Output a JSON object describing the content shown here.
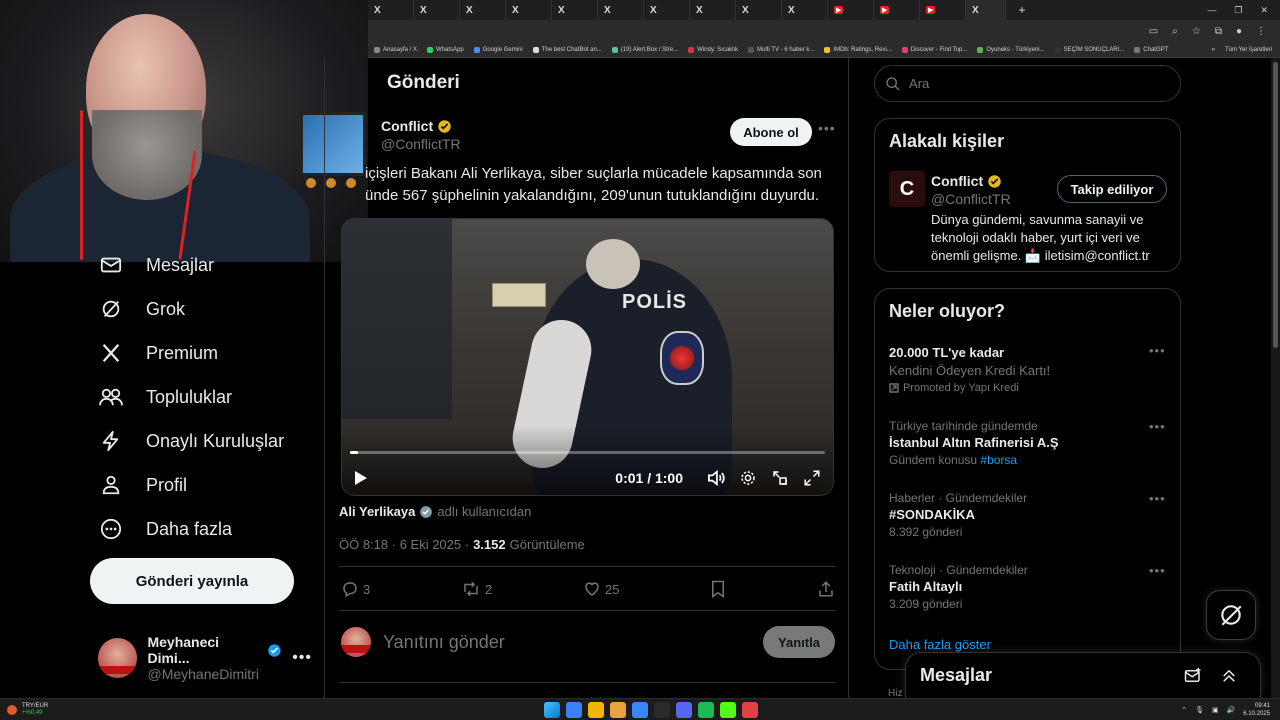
{
  "browser": {
    "tabs": [
      "X",
      "X",
      "X",
      "X",
      "X",
      "X",
      "X",
      "X",
      "X",
      "X",
      "X",
      "X",
      "X"
    ],
    "active_tab": "X",
    "new_tab": "+",
    "bookmarks": [
      {
        "label": "Anasayfa / X",
        "color": "#888888"
      },
      {
        "label": "WhatsApp",
        "color": "#25d366"
      },
      {
        "label": "Google Gemini",
        "color": "#4e8cf5"
      },
      {
        "label": "The best ChatBot an...",
        "color": "#dddddd"
      },
      {
        "label": "(19) Alert Box / Stre...",
        "color": "#53c6a8"
      },
      {
        "label": "Windy: Sıcaklık",
        "color": "#d2354a"
      },
      {
        "label": "Multi TV - 6 haber k...",
        "color": "#555555"
      },
      {
        "label": "IMDb: Ratings, Revi...",
        "color": "#f5c518"
      },
      {
        "label": "Discover - Find Top...",
        "color": "#e04070"
      },
      {
        "label": "Oyuneks - Türkiyeni...",
        "color": "#5bb552"
      },
      {
        "label": "SEÇİM SONUÇLARI...",
        "color": "#333333"
      },
      {
        "label": "ChatGPT",
        "color": "#777777"
      }
    ],
    "bookmarks_more": "»",
    "bookmarks_folder": "Tüm Yer İşaretleri"
  },
  "sidebar": {
    "items": [
      {
        "label": "Mesajlar",
        "icon": "mail-icon"
      },
      {
        "label": "Grok",
        "icon": "grok-icon"
      },
      {
        "label": "Premium",
        "icon": "x-logo-icon"
      },
      {
        "label": "Topluluklar",
        "icon": "communities-icon"
      },
      {
        "label": "Onaylı Kuruluşlar",
        "icon": "lightning-icon"
      },
      {
        "label": "Profil",
        "icon": "person-icon"
      },
      {
        "label": "Daha fazla",
        "icon": "more-circle-icon"
      }
    ],
    "post_button": "Gönderi yayınla",
    "account": {
      "name": "Meyhaneci Dimi...",
      "handle": "@MeyhaneDimitri",
      "more": "•••"
    }
  },
  "main": {
    "header": "Gönderi",
    "author": {
      "name": "Conflict",
      "handle": "@ConflictTR"
    },
    "subscribe": "Abone ol",
    "more": "•••",
    "text_line1": "içişleri Bakanı Ali Yerlikaya, siber suçlarla mücadele kapsamında son",
    "text_line2": "ünde 567 şüphelinin yakalandığını, 209'unun tutuklandığını duyurdu.",
    "video": {
      "vest_text": "POLİS",
      "time": "0:01 / 1:00",
      "progress": 0.0167
    },
    "credit": {
      "name": "Ali Yerlikaya",
      "suffix": "adlı kullanıcıdan"
    },
    "meta": {
      "time": "ÖÖ 8:18 · 6 Eki 2025 ·",
      "views": "3.152",
      "views_label": "Görüntüleme"
    },
    "actions": {
      "replies": "3",
      "reposts": "2",
      "likes": "25"
    },
    "reply_placeholder": "Yanıtını gönder",
    "reply_button": "Yanıtla"
  },
  "right": {
    "search_placeholder": "Ara",
    "related": {
      "title": "Alakalı kişiler",
      "name": "Conflict",
      "handle": "@ConflictTR",
      "follow": "Takip ediliyor",
      "avatar_letter": "C",
      "bio": "Dünya gündemi, savunma sanayii ve teknoloji odaklı haber, yurt içi veri ve önemli gelişme. 📩 iletisim@conflict.tr"
    },
    "trends": {
      "title": "Neler oluyor?",
      "items": [
        {
          "ctx": "",
          "title": "20.000 TL'ye kadar",
          "sub": "Kendini Ödeyen Kredi Kartı!",
          "promo": "Promoted by Yapı Kredi"
        },
        {
          "ctx": "Türkiye tarihinde gündemde",
          "title": "İstanbul Altın Rafinerisi A.Ş",
          "sub": "Gündem konusu",
          "tag": "#borsa"
        },
        {
          "ctx": "Haberler · Gündemdekiler",
          "title": "#SONDAKİKA",
          "sub": "8.392 gönderi"
        },
        {
          "ctx": "Teknoloji · Gündemdekiler",
          "title": "Fatih Altaylı",
          "sub": "3.209 gönderi"
        }
      ],
      "show_more": "Daha fazla göster"
    },
    "messages_dock": "Mesajlar",
    "peek": "Hiz"
  },
  "taskbar": {
    "ticker_pair": "TRY/EUR",
    "ticker_change": "+%0,49",
    "time": "09:41",
    "date": "6.10.2025",
    "apps": [
      "#3b82f6",
      "#f2b705",
      "#e8a33b",
      "#3a86ff",
      "#2a2a2a",
      "#5865f2",
      "#1db954",
      "#53fc18",
      "#e04343"
    ]
  },
  "colors": {
    "accent": "#1d9bf0",
    "verified_gold": "#e2b719",
    "verified_blue": "#1d9bf0",
    "background": "#000000"
  }
}
